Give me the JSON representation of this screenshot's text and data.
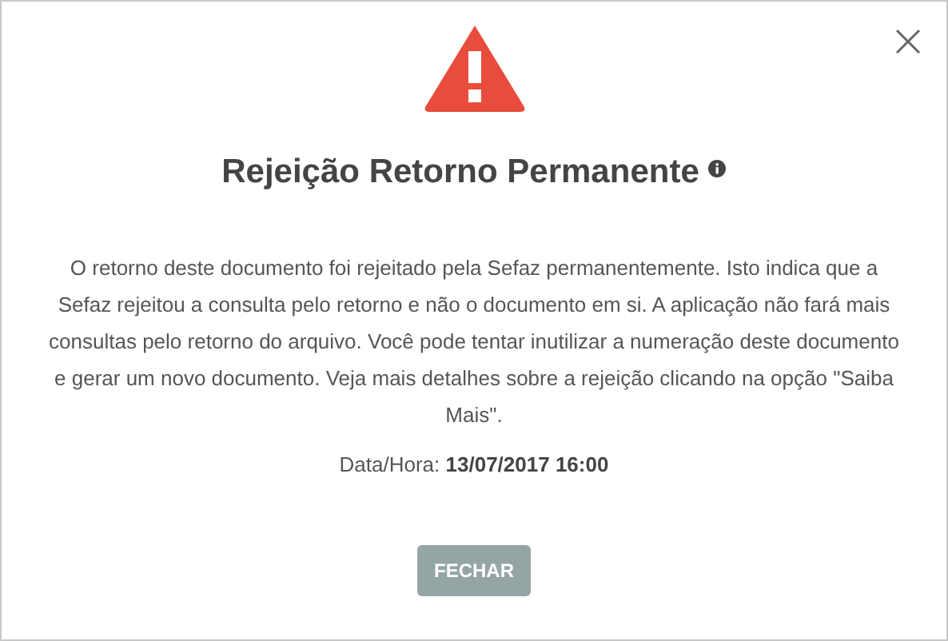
{
  "dialog": {
    "title": "Rejeição Retorno Permanente",
    "message": "O retorno deste documento foi rejeitado pela Sefaz permanentemente. Isto indica que a Sefaz rejeitou a consulta pelo retorno e não o documento em si. A aplicação não fará mais consultas pelo retorno do arquivo. Você pode tentar inutilizar a numeração deste documento e gerar um novo documento. Veja mais detalhes sobre a rejeição clicando na opção \"Saiba Mais\".",
    "timestamp": "Data/Hora: **13/07/2017 16:00**",
    "buttons": [
      "FECHAR"
    ]
  }
}
